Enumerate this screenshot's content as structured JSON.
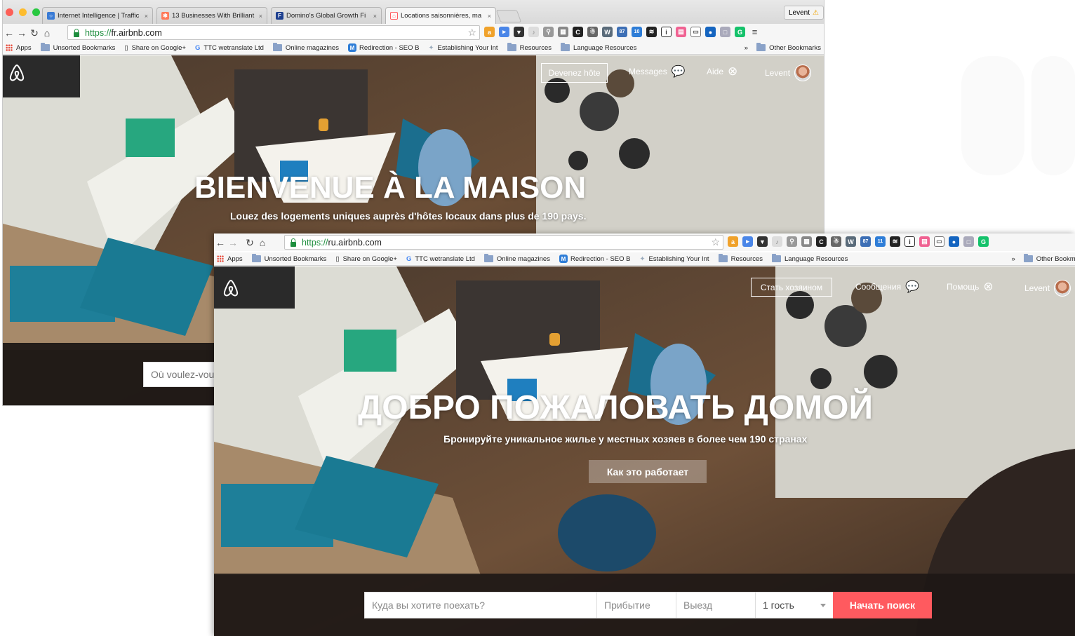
{
  "windows": [
    {
      "tabs": [
        {
          "title": "Internet Intelligence | Traffic",
          "favicon_color": "#3a7bd5",
          "active": false
        },
        {
          "title": "13 Businesses With Brilliant",
          "favicon_color": "#ff7a59",
          "active": false
        },
        {
          "title": "Domino's Global Growth Fi",
          "favicon_color": "#1d3f8f",
          "favicon_letter": "F",
          "active": false
        },
        {
          "title": "Locations saisonnières, ma",
          "favicon_color": "#ff5a5f",
          "active": true
        }
      ],
      "profile": "Levent",
      "url_scheme": "https://",
      "url_host": "fr.airbnb.com",
      "nav": {
        "host_button": "Devenez hôte",
        "messages": "Messages",
        "help": "Aide",
        "user": "Levent"
      },
      "headline": "BIENVENUE À LA MAISON",
      "subheadline": "Louez des logements uniques auprès d'hôtes locaux dans plus de 190 pays.",
      "search_placeholder": "Où voulez-vous"
    },
    {
      "url_scheme": "https://",
      "url_host": "ru.airbnb.com",
      "nav": {
        "host_button": "Стать хозяином",
        "messages": "Сообщения",
        "help": "Помощь",
        "user": "Levent"
      },
      "headline": "ДОБРО ПОЖАЛОВАТЬ ДОМОЙ",
      "subheadline": "Бронируйте уникальное жилье у местных хозяев в более чем 190 странах",
      "how_button": "Как это работает",
      "search": {
        "where_placeholder": "Куда вы хотите поехать?",
        "checkin_placeholder": "Прибытие",
        "checkout_placeholder": "Выезд",
        "guests": "1 гость",
        "submit": "Начать поиск"
      }
    }
  ],
  "bookmarks": {
    "apps": "Apps",
    "items": [
      "Unsorted Bookmarks",
      "Share on Google+",
      "TTC wetranslate Ltd",
      "Online magazines",
      "Redirection - SEO B",
      "Establishing Your Int",
      "Resources",
      "Language Resources"
    ],
    "overflow": "»",
    "other": "Other Bookmarks",
    "other_truncated": "Other Bookma"
  },
  "extensions": {
    "badge_87": "87",
    "badge_10": "10",
    "badge_11": "11"
  },
  "colors": {
    "airbnb_red": "#ff5a5f",
    "secure_green": "#1e8e3e"
  }
}
